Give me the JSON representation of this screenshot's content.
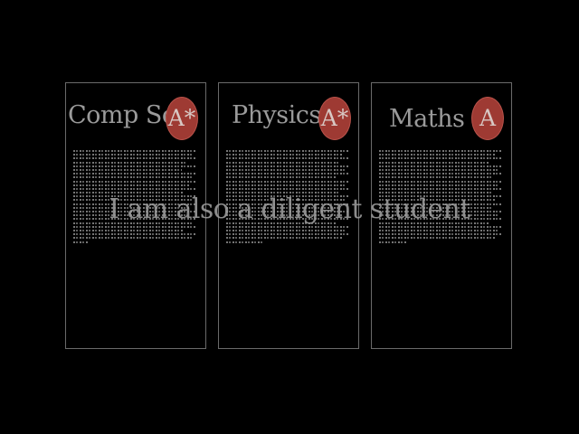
{
  "cards": [
    {
      "subject": "Comp Sci",
      "grade": "A*"
    },
    {
      "subject": "Physics",
      "grade": "A*"
    },
    {
      "subject": "Maths",
      "grade": "A"
    }
  ],
  "overlay_text": "I am also a diligent student",
  "colors": {
    "background": "#000000",
    "card_border": "#6a6a6a",
    "grade_badge": "#9e3a33",
    "text": "#9a9a9a"
  }
}
